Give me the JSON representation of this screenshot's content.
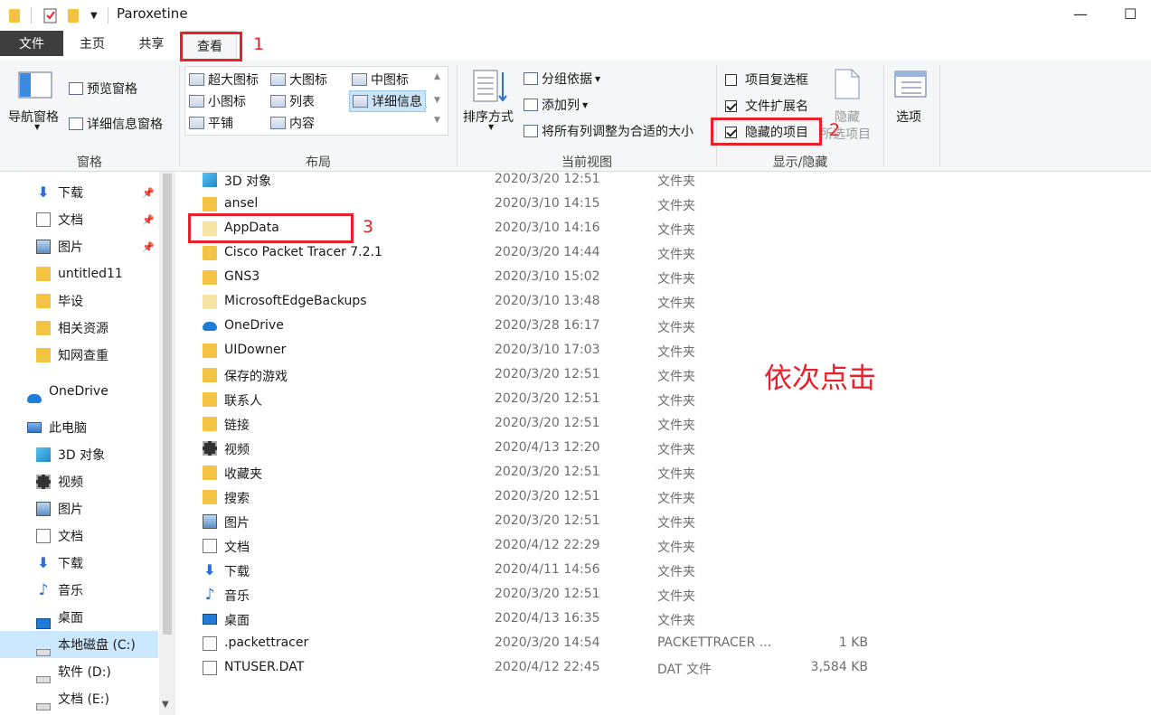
{
  "window": {
    "title": "Paroxetine",
    "minimize_glyph": "—",
    "maximize_glyph": "☐"
  },
  "tabs": {
    "file": "文件",
    "home": "主页",
    "share": "共享",
    "view": "查看"
  },
  "ribbon": {
    "panes": {
      "nav_pane": "导航窗格",
      "preview_pane": "预览窗格",
      "details_pane": "详细信息窗格",
      "group_label": "窗格"
    },
    "layout": {
      "items": [
        "超大图标",
        "大图标",
        "中图标",
        "小图标",
        "列表",
        "详细信息",
        "平铺",
        "内容"
      ],
      "selected": "详细信息",
      "group_label": "布局"
    },
    "current_view": {
      "sort_by": "排序方式",
      "group_by": "分组依据",
      "add_column": "添加列",
      "fit_columns": "将所有列调整为合适的大小",
      "group_label": "当前视图"
    },
    "show_hide": {
      "item_checkboxes": {
        "label": "项目复选框",
        "checked": false
      },
      "file_extensions": {
        "label": "文件扩展名",
        "checked": true
      },
      "hidden_items": {
        "label": "隐藏的项目",
        "checked": true
      },
      "hide_selected": "隐藏",
      "hide_selected_2": "所选项目",
      "group_label": "显示/隐藏"
    },
    "options": "选项"
  },
  "annotations": {
    "n1": "1",
    "n2": "2",
    "n3": "3",
    "instruction": "依次点击"
  },
  "sidebar": {
    "items": [
      {
        "label": "下载",
        "icon": "download-icon",
        "pinned": true
      },
      {
        "label": "文档",
        "icon": "document-icon",
        "pinned": true
      },
      {
        "label": "图片",
        "icon": "pictures-icon",
        "pinned": true
      },
      {
        "label": "untitled11",
        "icon": "folder-icon",
        "pinned": false
      },
      {
        "label": "毕设",
        "icon": "folder-icon",
        "pinned": false
      },
      {
        "label": "相关资源",
        "icon": "folder-icon",
        "pinned": false
      },
      {
        "label": "知网查重",
        "icon": "folder-icon",
        "pinned": false
      },
      {
        "label": "OneDrive",
        "icon": "onedrive-icon",
        "pinned": false
      },
      {
        "label": "此电脑",
        "icon": "this-pc-icon",
        "pinned": false
      },
      {
        "label": "3D 对象",
        "icon": "3d-objects-icon",
        "pinned": false
      },
      {
        "label": "视频",
        "icon": "video-icon",
        "pinned": false
      },
      {
        "label": "图片",
        "icon": "pictures-icon",
        "pinned": false
      },
      {
        "label": "文档",
        "icon": "document-icon",
        "pinned": false
      },
      {
        "label": "下载",
        "icon": "download-icon",
        "pinned": false
      },
      {
        "label": "音乐",
        "icon": "music-icon",
        "pinned": false
      },
      {
        "label": "桌面",
        "icon": "desktop-icon",
        "pinned": false
      },
      {
        "label": "本地磁盘 (C:)",
        "icon": "drive-c-icon",
        "pinned": false,
        "selected": true
      },
      {
        "label": "软件 (D:)",
        "icon": "drive-icon",
        "pinned": false
      },
      {
        "label": "文档 (E:)",
        "icon": "drive-icon",
        "pinned": false
      }
    ]
  },
  "files": [
    {
      "name": "3D 对象",
      "date": "2020/3/20 12:51",
      "type": "文件夹",
      "size": "",
      "icon": "3d-objects-icon"
    },
    {
      "name": "ansel",
      "date": "2020/3/10 14:15",
      "type": "文件夹",
      "size": "",
      "icon": "folder-icon"
    },
    {
      "name": "AppData",
      "date": "2020/3/10 14:16",
      "type": "文件夹",
      "size": "",
      "icon": "hidden-folder-icon"
    },
    {
      "name": "Cisco Packet Tracer 7.2.1",
      "date": "2020/3/20 14:44",
      "type": "文件夹",
      "size": "",
      "icon": "folder-icon"
    },
    {
      "name": "GNS3",
      "date": "2020/3/10 15:02",
      "type": "文件夹",
      "size": "",
      "icon": "folder-icon"
    },
    {
      "name": "MicrosoftEdgeBackups",
      "date": "2020/3/10 13:48",
      "type": "文件夹",
      "size": "",
      "icon": "hidden-folder-icon"
    },
    {
      "name": "OneDrive",
      "date": "2020/3/28 16:17",
      "type": "文件夹",
      "size": "",
      "icon": "onedrive-icon"
    },
    {
      "name": "UIDowner",
      "date": "2020/3/10 17:03",
      "type": "文件夹",
      "size": "",
      "icon": "folder-icon"
    },
    {
      "name": "保存的游戏",
      "date": "2020/3/20 12:51",
      "type": "文件夹",
      "size": "",
      "icon": "saved-games-icon"
    },
    {
      "name": "联系人",
      "date": "2020/3/20 12:51",
      "type": "文件夹",
      "size": "",
      "icon": "contacts-icon"
    },
    {
      "name": "链接",
      "date": "2020/3/20 12:51",
      "type": "文件夹",
      "size": "",
      "icon": "links-icon"
    },
    {
      "name": "视频",
      "date": "2020/4/13 12:20",
      "type": "文件夹",
      "size": "",
      "icon": "video-icon"
    },
    {
      "name": "收藏夹",
      "date": "2020/3/20 12:51",
      "type": "文件夹",
      "size": "",
      "icon": "favorites-icon"
    },
    {
      "name": "搜索",
      "date": "2020/3/20 12:51",
      "type": "文件夹",
      "size": "",
      "icon": "searches-icon"
    },
    {
      "name": "图片",
      "date": "2020/3/20 12:51",
      "type": "文件夹",
      "size": "",
      "icon": "pictures-icon"
    },
    {
      "name": "文档",
      "date": "2020/4/12 22:29",
      "type": "文件夹",
      "size": "",
      "icon": "document-icon"
    },
    {
      "name": "下载",
      "date": "2020/4/11 14:56",
      "type": "文件夹",
      "size": "",
      "icon": "download-icon"
    },
    {
      "name": "音乐",
      "date": "2020/3/20 12:51",
      "type": "文件夹",
      "size": "",
      "icon": "music-icon"
    },
    {
      "name": "桌面",
      "date": "2020/4/13 16:35",
      "type": "文件夹",
      "size": "",
      "icon": "desktop-icon"
    },
    {
      "name": ".packettracer",
      "date": "2020/3/20 14:54",
      "type": "PACKETTRACER ...",
      "size": "1 KB",
      "icon": "file-icon"
    },
    {
      "name": "NTUSER.DAT",
      "date": "2020/4/12 22:45",
      "type": "DAT 文件",
      "size": "3,584 KB",
      "icon": "file-icon"
    }
  ],
  "colors": {
    "annotation": "#e8202a",
    "file_tab": "#3e3e3e",
    "selection": "#cce8ff"
  }
}
